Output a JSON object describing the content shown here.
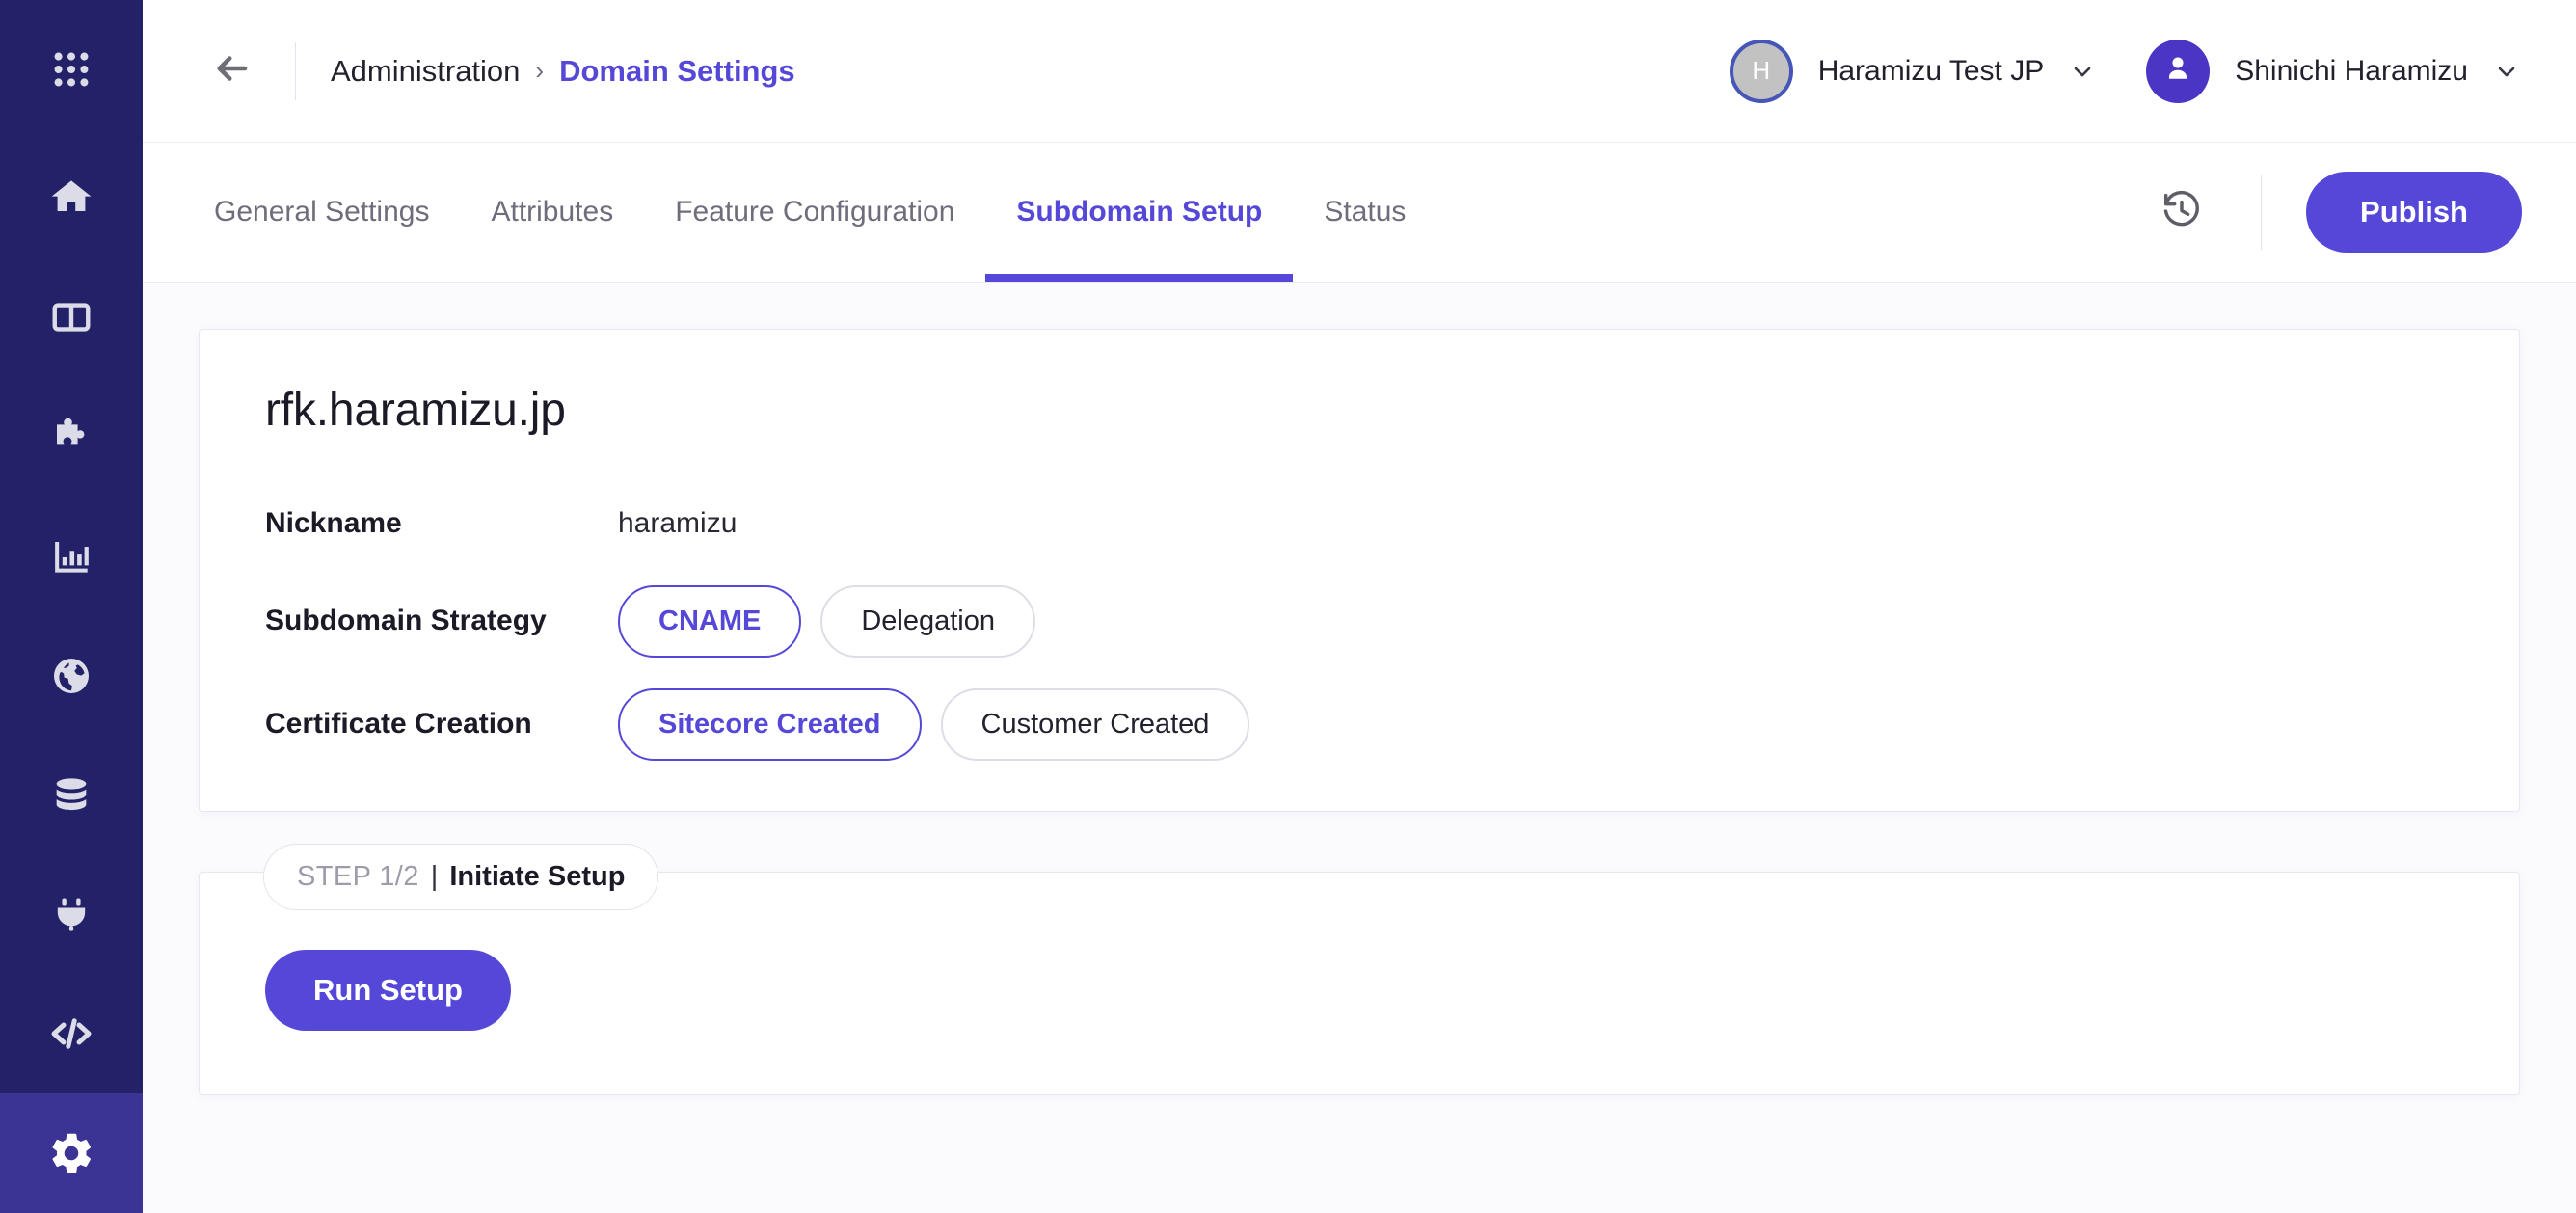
{
  "sidebar": {
    "bg_color": "#232167",
    "active_color": "#3b3494",
    "items": [
      {
        "name": "app-launcher",
        "icon": "grid-dots-icon",
        "active": false
      },
      {
        "name": "home",
        "icon": "home-icon",
        "active": false
      },
      {
        "name": "pages",
        "icon": "layout-columns-icon",
        "active": false
      },
      {
        "name": "components",
        "icon": "puzzle-piece-icon",
        "active": false
      },
      {
        "name": "analytics",
        "icon": "bar-chart-icon",
        "active": false
      },
      {
        "name": "sites",
        "icon": "globe-icon",
        "active": false
      },
      {
        "name": "content-hub",
        "icon": "database-icon",
        "active": false
      },
      {
        "name": "connect",
        "icon": "plug-icon",
        "active": false
      },
      {
        "name": "developer",
        "icon": "code-icon",
        "active": false
      },
      {
        "name": "settings",
        "icon": "gear-icon",
        "active": true
      }
    ]
  },
  "topbar": {
    "back_icon": "arrow-left-icon",
    "breadcrumb": {
      "root": "Administration",
      "separator": "›",
      "current": "Domain Settings"
    },
    "org": {
      "initial": "H",
      "label": "Haramizu Test JP",
      "caret_icon": "chevron-down-icon"
    },
    "user": {
      "avatar_icon": "person-icon",
      "label": "Shinichi Haramizu",
      "caret_icon": "chevron-down-icon"
    }
  },
  "tabbar": {
    "tabs": [
      {
        "label": "General Settings",
        "active": false
      },
      {
        "label": "Attributes",
        "active": false
      },
      {
        "label": "Feature Configuration",
        "active": false
      },
      {
        "label": "Subdomain Setup",
        "active": true
      },
      {
        "label": "Status",
        "active": false
      }
    ],
    "history_icon": "history-clock-icon",
    "publish_label": "Publish"
  },
  "domain_card": {
    "title": "rfk.haramizu.jp",
    "rows": [
      {
        "label": "Nickname",
        "type": "text",
        "value": "haramizu"
      },
      {
        "label": "Subdomain Strategy",
        "type": "segmented",
        "options": [
          {
            "label": "CNAME",
            "selected": true
          },
          {
            "label": "Delegation",
            "selected": false
          }
        ]
      },
      {
        "label": "Certificate Creation",
        "type": "segmented",
        "options": [
          {
            "label": "Sitecore Created",
            "selected": true
          },
          {
            "label": "Customer Created",
            "selected": false
          }
        ]
      }
    ]
  },
  "step_card": {
    "badge": {
      "kicker": "STEP 1/2",
      "pipe": "|",
      "name": "Initiate Setup"
    },
    "run_label": "Run Setup"
  },
  "colors": {
    "accent": "#5548d9",
    "sidebar": "#232167",
    "page_bg": "#fbfbfd",
    "card_border": "#e7e5f6",
    "muted_text": "#6f6d7b"
  }
}
